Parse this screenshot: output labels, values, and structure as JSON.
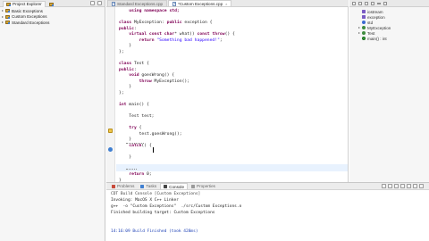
{
  "explorer": {
    "tabs": [
      {
        "label": "Project Explorer",
        "active": true,
        "icon": "project-explorer-icon"
      },
      {
        "label": "",
        "active": false,
        "icon": "folder-icon"
      }
    ],
    "projects": [
      {
        "label": "Basic Exceptions"
      },
      {
        "label": "Custom Exceptions"
      },
      {
        "label": "Standard Exceptions"
      }
    ]
  },
  "editor": {
    "tabs": [
      {
        "label": "Standard Exceptions.cpp",
        "active": false
      },
      {
        "label": "*Custom Exceptions.cpp",
        "active": true
      }
    ],
    "lines": [
      [
        {
          "t": "    "
        },
        {
          "t": "using namespace std;",
          "k": "kw"
        }
      ],
      [
        {
          "t": ""
        }
      ],
      [
        {
          "t": "class",
          "k": "kw"
        },
        {
          "t": " MyException: "
        },
        {
          "t": "public",
          "k": "kw"
        },
        {
          "t": " exception {"
        }
      ],
      [
        {
          "t": "public",
          "k": "kw"
        },
        {
          "t": ":"
        }
      ],
      [
        {
          "t": "    "
        },
        {
          "t": "virtual const char",
          "k": "kw"
        },
        {
          "t": "* what() "
        },
        {
          "t": "const throw",
          "k": "kw"
        },
        {
          "t": "() {"
        }
      ],
      [
        {
          "t": "        "
        },
        {
          "t": "return",
          "k": "kw"
        },
        {
          "t": " "
        },
        {
          "t": "\"Something bad happened!\"",
          "k": "str"
        },
        {
          "t": ";"
        }
      ],
      [
        {
          "t": "    }"
        }
      ],
      [
        {
          "t": "};"
        }
      ],
      [
        {
          "t": ""
        }
      ],
      [
        {
          "t": "class",
          "k": "kw"
        },
        {
          "t": " Test {"
        }
      ],
      [
        {
          "t": "public",
          "k": "kw"
        },
        {
          "t": ":"
        }
      ],
      [
        {
          "t": "    "
        },
        {
          "t": "void",
          "k": "kw"
        },
        {
          "t": " goesWrong() {"
        }
      ],
      [
        {
          "t": "        "
        },
        {
          "t": "throw",
          "k": "kw"
        },
        {
          "t": " MyException();"
        }
      ],
      [
        {
          "t": "    }"
        }
      ],
      [
        {
          "t": "};"
        }
      ],
      [
        {
          "t": ""
        }
      ],
      [
        {
          "t": "int",
          "k": "kw"
        },
        {
          "t": " main() {"
        }
      ],
      [
        {
          "t": ""
        }
      ],
      [
        {
          "t": "    Test test;"
        }
      ],
      [
        {
          "t": ""
        }
      ],
      [
        {
          "t": "    "
        },
        {
          "t": "try",
          "k": "kw"
        },
        {
          "t": " {"
        }
      ],
      [
        {
          "t": "        test.goesWrong();"
        }
      ],
      [
        {
          "t": "    }"
        }
      ],
      [
        {
          "t": "    "
        },
        {
          "t": "catch",
          "k": "kw"
        },
        {
          "t": "() {"
        }
      ],
      [
        {
          "t": ""
        }
      ],
      [
        {
          "t": "    }"
        }
      ],
      [
        {
          "t": ""
        }
      ],
      [
        {
          "t": ""
        }
      ],
      [
        {
          "t": "    "
        },
        {
          "t": "return",
          "k": "kw"
        },
        {
          "t": " 0;"
        }
      ],
      [
        {
          "t": "}"
        }
      ]
    ]
  },
  "outline": {
    "items": [
      {
        "label": "iostream",
        "kind": "include",
        "indent": 0
      },
      {
        "label": "exception",
        "kind": "include",
        "indent": 0
      },
      {
        "label": "std",
        "kind": "namespace",
        "indent": 0
      },
      {
        "label": "MyException",
        "kind": "class",
        "indent": 0
      },
      {
        "label": "Test",
        "kind": "class",
        "indent": 0
      },
      {
        "label": "main() : int",
        "kind": "function",
        "indent": 0
      }
    ]
  },
  "bottom": {
    "tabs": [
      {
        "label": "Problems",
        "active": false,
        "color": "#c84a3a"
      },
      {
        "label": "Tasks",
        "active": false,
        "color": "#3f7fd1"
      },
      {
        "label": "Console",
        "active": true,
        "color": "#444444"
      },
      {
        "label": "Properties",
        "active": false,
        "color": "#9a9a9a"
      }
    ],
    "console_title": "CDT Build Console [Custom Exceptions]",
    "console_lines": [
      {
        "text": "Invoking: MacOS X C++ Linker",
        "style": "normal"
      },
      {
        "text": "g++  -o \"Custom Exceptions\"  ./src/Custom Exceptions.o",
        "style": "normal"
      },
      {
        "text": "Finished building target: Custom Exceptions",
        "style": "normal"
      },
      {
        "text": "",
        "style": "normal"
      },
      {
        "text": "",
        "style": "normal"
      },
      {
        "text": "14:16:09 Build Finished (took 428ms)",
        "style": "blue"
      }
    ]
  }
}
